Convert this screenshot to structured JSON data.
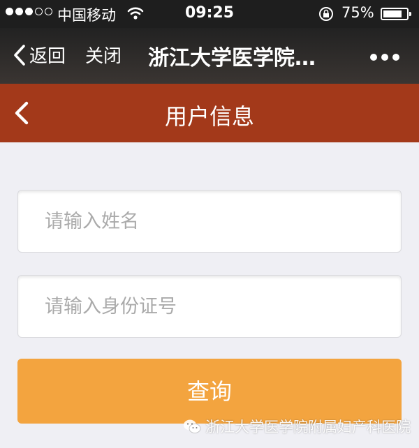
{
  "status_bar": {
    "carrier": "中国移动",
    "time": "09:25",
    "battery_percent": "75%",
    "battery_level": 0.75,
    "signal_bars_filled": 3,
    "signal_bars_total": 5
  },
  "nav_bar": {
    "back_label": "返回",
    "close_label": "关闭",
    "title": "浙江大学医学院…"
  },
  "header": {
    "title": "用户信息"
  },
  "form": {
    "name_placeholder": "请输入姓名",
    "id_placeholder": "请输入身份证号",
    "submit_label": "查询"
  },
  "watermark": {
    "text": "浙江大学医学院附属妇产科医院"
  },
  "colors": {
    "header_bg": "#a3391a",
    "button_bg": "#f3a43f",
    "page_bg": "#efeff4"
  }
}
